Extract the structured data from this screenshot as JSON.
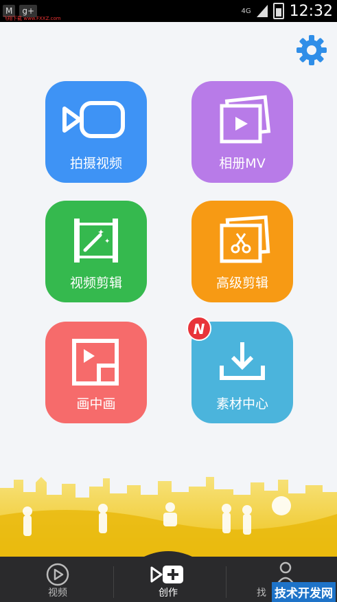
{
  "status_bar": {
    "left_icons": [
      "mail-icon",
      "google-plus-icon"
    ],
    "watermark": "飞翔下载 www.FXXZ.com",
    "network": "4G",
    "time": "12:32"
  },
  "settings": {
    "icon": "gear-icon",
    "color": "#2f8ee8"
  },
  "tiles": [
    {
      "label": "拍摄视频",
      "icon": "camera-icon",
      "color": "#3e93f5"
    },
    {
      "label": "相册MV",
      "icon": "photo-album-play-icon",
      "color": "#b87be8"
    },
    {
      "label": "视频剪辑",
      "icon": "film-edit-icon",
      "color": "#35b94e"
    },
    {
      "label": "高级剪辑",
      "icon": "advanced-cut-icon",
      "color": "#f79a14"
    },
    {
      "label": "画中画",
      "icon": "picture-in-picture-icon",
      "color": "#f66b6b"
    },
    {
      "label": "素材中心",
      "icon": "download-tray-icon",
      "color": "#4bb4dc",
      "badge": "N"
    }
  ],
  "tabbar": {
    "tabs": [
      {
        "label": "视频",
        "icon": "play-circle-icon"
      },
      {
        "label": "创作",
        "icon": "create-icon"
      },
      {
        "label": "找",
        "icon": "person-icon"
      }
    ],
    "watermark": "技术开发网"
  }
}
